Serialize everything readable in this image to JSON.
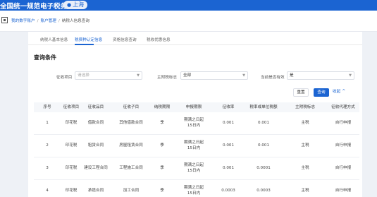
{
  "header": {
    "title": "全国统一规范电子税务局",
    "location": "上海",
    "location_icon": "location-pin-icon"
  },
  "breadcrumb": {
    "icon": "menu-square-icon",
    "items": [
      "我的数字账户",
      "账户管理",
      "纳税人信息查询"
    ],
    "separator": "/"
  },
  "tabs": [
    {
      "label": "纳税人基本信息",
      "active": false
    },
    {
      "label": "税费种认定信息",
      "active": true
    },
    {
      "label": "资格信息查询",
      "active": false
    },
    {
      "label": "税收优惠信息",
      "active": false
    }
  ],
  "query": {
    "title": "查询条件",
    "fields": {
      "item": {
        "label": "征收项目",
        "placeholder": "请选择"
      },
      "main_flag": {
        "label": "主附税标志",
        "value": "全部"
      },
      "current_valid": {
        "label": "当前是否有效",
        "value": "是"
      }
    },
    "buttons": {
      "reset": "重置",
      "query": "查询",
      "collapse": "收起"
    }
  },
  "table": {
    "columns": [
      "序号",
      "征收项目",
      "征收品目",
      "征收子目",
      "纳税期限",
      "申报期限",
      "征收率",
      "税率或单位税额",
      "主附税标志",
      "征收代理方式"
    ],
    "rows": [
      [
        "1",
        "印花税",
        "借款合同",
        "其他借款合同",
        "季",
        "期满之日起\n15日内",
        "0.001",
        "0.001",
        "主税",
        "自行申报"
      ],
      [
        "2",
        "印花税",
        "租赁合同",
        "房屋租赁合同",
        "季",
        "期满之日起\n15日内",
        "0.001",
        "0.001",
        "主税",
        "自行申报"
      ],
      [
        "3",
        "印花税",
        "建设工程合同",
        "工程施工合同",
        "季",
        "期满之日起\n15日内",
        "0.001",
        "0.0001",
        "主税",
        "自行申报"
      ],
      [
        "4",
        "印花税",
        "承揽合同",
        "加工合同",
        "季",
        "期满之日起\n15日内",
        "0.0003",
        "0.0003",
        "主税",
        "自行申报"
      ]
    ]
  }
}
